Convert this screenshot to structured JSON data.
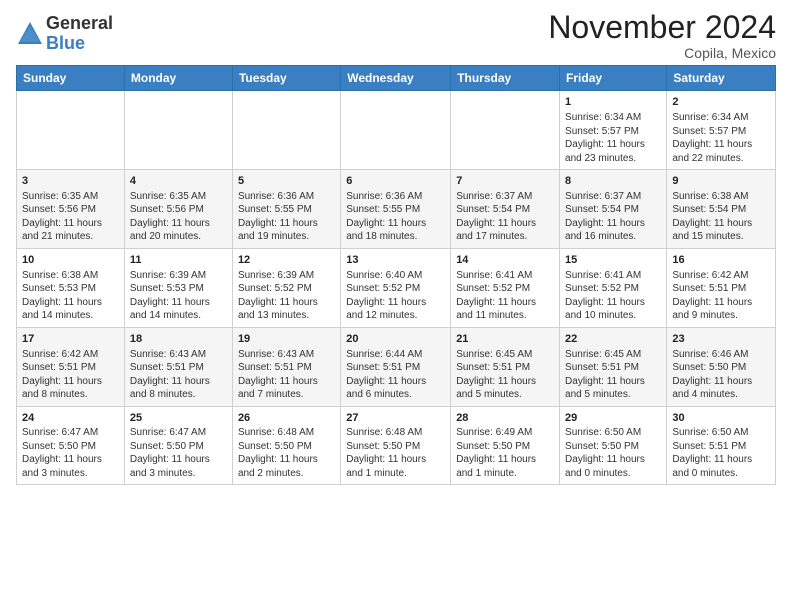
{
  "logo": {
    "general": "General",
    "blue": "Blue"
  },
  "title": "November 2024",
  "subtitle": "Copila, Mexico",
  "days_of_week": [
    "Sunday",
    "Monday",
    "Tuesday",
    "Wednesday",
    "Thursday",
    "Friday",
    "Saturday"
  ],
  "weeks": [
    [
      {
        "day": "",
        "info": ""
      },
      {
        "day": "",
        "info": ""
      },
      {
        "day": "",
        "info": ""
      },
      {
        "day": "",
        "info": ""
      },
      {
        "day": "",
        "info": ""
      },
      {
        "day": "1",
        "info": "Sunrise: 6:34 AM\nSunset: 5:57 PM\nDaylight: 11 hours and 23 minutes."
      },
      {
        "day": "2",
        "info": "Sunrise: 6:34 AM\nSunset: 5:57 PM\nDaylight: 11 hours and 22 minutes."
      }
    ],
    [
      {
        "day": "3",
        "info": "Sunrise: 6:35 AM\nSunset: 5:56 PM\nDaylight: 11 hours and 21 minutes."
      },
      {
        "day": "4",
        "info": "Sunrise: 6:35 AM\nSunset: 5:56 PM\nDaylight: 11 hours and 20 minutes."
      },
      {
        "day": "5",
        "info": "Sunrise: 6:36 AM\nSunset: 5:55 PM\nDaylight: 11 hours and 19 minutes."
      },
      {
        "day": "6",
        "info": "Sunrise: 6:36 AM\nSunset: 5:55 PM\nDaylight: 11 hours and 18 minutes."
      },
      {
        "day": "7",
        "info": "Sunrise: 6:37 AM\nSunset: 5:54 PM\nDaylight: 11 hours and 17 minutes."
      },
      {
        "day": "8",
        "info": "Sunrise: 6:37 AM\nSunset: 5:54 PM\nDaylight: 11 hours and 16 minutes."
      },
      {
        "day": "9",
        "info": "Sunrise: 6:38 AM\nSunset: 5:54 PM\nDaylight: 11 hours and 15 minutes."
      }
    ],
    [
      {
        "day": "10",
        "info": "Sunrise: 6:38 AM\nSunset: 5:53 PM\nDaylight: 11 hours and 14 minutes."
      },
      {
        "day": "11",
        "info": "Sunrise: 6:39 AM\nSunset: 5:53 PM\nDaylight: 11 hours and 14 minutes."
      },
      {
        "day": "12",
        "info": "Sunrise: 6:39 AM\nSunset: 5:52 PM\nDaylight: 11 hours and 13 minutes."
      },
      {
        "day": "13",
        "info": "Sunrise: 6:40 AM\nSunset: 5:52 PM\nDaylight: 11 hours and 12 minutes."
      },
      {
        "day": "14",
        "info": "Sunrise: 6:41 AM\nSunset: 5:52 PM\nDaylight: 11 hours and 11 minutes."
      },
      {
        "day": "15",
        "info": "Sunrise: 6:41 AM\nSunset: 5:52 PM\nDaylight: 11 hours and 10 minutes."
      },
      {
        "day": "16",
        "info": "Sunrise: 6:42 AM\nSunset: 5:51 PM\nDaylight: 11 hours and 9 minutes."
      }
    ],
    [
      {
        "day": "17",
        "info": "Sunrise: 6:42 AM\nSunset: 5:51 PM\nDaylight: 11 hours and 8 minutes."
      },
      {
        "day": "18",
        "info": "Sunrise: 6:43 AM\nSunset: 5:51 PM\nDaylight: 11 hours and 8 minutes."
      },
      {
        "day": "19",
        "info": "Sunrise: 6:43 AM\nSunset: 5:51 PM\nDaylight: 11 hours and 7 minutes."
      },
      {
        "day": "20",
        "info": "Sunrise: 6:44 AM\nSunset: 5:51 PM\nDaylight: 11 hours and 6 minutes."
      },
      {
        "day": "21",
        "info": "Sunrise: 6:45 AM\nSunset: 5:51 PM\nDaylight: 11 hours and 5 minutes."
      },
      {
        "day": "22",
        "info": "Sunrise: 6:45 AM\nSunset: 5:51 PM\nDaylight: 11 hours and 5 minutes."
      },
      {
        "day": "23",
        "info": "Sunrise: 6:46 AM\nSunset: 5:50 PM\nDaylight: 11 hours and 4 minutes."
      }
    ],
    [
      {
        "day": "24",
        "info": "Sunrise: 6:47 AM\nSunset: 5:50 PM\nDaylight: 11 hours and 3 minutes."
      },
      {
        "day": "25",
        "info": "Sunrise: 6:47 AM\nSunset: 5:50 PM\nDaylight: 11 hours and 3 minutes."
      },
      {
        "day": "26",
        "info": "Sunrise: 6:48 AM\nSunset: 5:50 PM\nDaylight: 11 hours and 2 minutes."
      },
      {
        "day": "27",
        "info": "Sunrise: 6:48 AM\nSunset: 5:50 PM\nDaylight: 11 hours and 1 minute."
      },
      {
        "day": "28",
        "info": "Sunrise: 6:49 AM\nSunset: 5:50 PM\nDaylight: 11 hours and 1 minute."
      },
      {
        "day": "29",
        "info": "Sunrise: 6:50 AM\nSunset: 5:50 PM\nDaylight: 11 hours and 0 minutes."
      },
      {
        "day": "30",
        "info": "Sunrise: 6:50 AM\nSunset: 5:51 PM\nDaylight: 11 hours and 0 minutes."
      }
    ]
  ]
}
